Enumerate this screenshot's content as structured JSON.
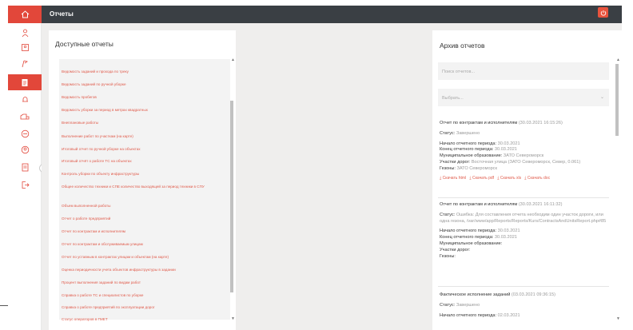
{
  "header": {
    "title": "Отчеты"
  },
  "sidebar": {
    "items": [
      {
        "icon": "users-group-icon"
      },
      {
        "icon": "person-card-icon"
      },
      {
        "icon": "route-flag-icon"
      },
      {
        "icon": "reports-document-icon"
      },
      {
        "icon": "bell-icon"
      },
      {
        "icon": "vehicle-icon"
      },
      {
        "icon": "minus-circle-icon"
      },
      {
        "icon": "person-circle-icon"
      },
      {
        "icon": "settings-document-icon"
      },
      {
        "icon": "logout-arrow-icon"
      }
    ]
  },
  "left_panel": {
    "title": "Доступные отчеты",
    "items": [
      "Ведомость заданий и прохода по треку",
      "Ведомость заданий по ручной уборке",
      "Ведомость пробегов",
      "Ведомость уборки за период в метрах квадратных",
      "Внеплановые работы",
      "Выполнение работ по участкам (на карте)",
      "Итоговый отчет по ручной уборке на объектах",
      "Итоговый отчёт о работе ТС на объектах",
      "Контроль уборки по объекту инфраструктуры",
      "Общее количество техники и СПЕ количество выходящей за период техники в СПУ",
      "Объем выполненной работы",
      "Отчет о работе предприятий",
      "Отчет по контрактам и исполнителям",
      "Отчет по контрактам и обслуживаемым улицам",
      "Отчет по уставным в контрактах улицам и объектам (на карте)",
      "Оценка периодичности учета объектов инфраструктуры в задании",
      "Процент выполнения заданий по видам работ",
      "Справка о работе ТС и специалистов по уборке",
      "Справка о работе предприятий по эксплуатации дорог",
      "Статус операторов в ГМЕТ"
    ]
  },
  "right_panel": {
    "title": "Архив отчетов",
    "search_placeholder": "Поиск отчетов...",
    "select_placeholder": "Выбрать...",
    "reports": [
      {
        "title": "Отчет по контрактам и исполнителям",
        "date": "(30.03.2021 16:15:26)",
        "status_label": "Статус:",
        "status": "Завершено",
        "lines": [
          {
            "label": "Начало отчетного периода:",
            "value": "30.03.2021"
          },
          {
            "label": "Конец отчетного периода:",
            "value": "30.03.2021"
          },
          {
            "label": "Муниципальное образование:",
            "value": "ЗАТО Североморск"
          },
          {
            "label": "Участки дорог:",
            "value": "Восточная улица (ЗАТО Североморск, Север, 0.061)"
          },
          {
            "label": "Гезоны:",
            "value": "ЗАТО Североморск"
          }
        ],
        "links": [
          "Скачать html",
          "Скачать pdf",
          "Скачать xls",
          "Скачать doc"
        ]
      },
      {
        "title": "Отчет по контрактам и исполнителям",
        "date": "(30.03.2021 16:11:32)",
        "status_label": "Статус:",
        "status": "Ошибка: Для составления отчета необходим один участок дороги, или одна гезона, /var/www/app/Reports/Reports/Kurs/ContractsAndUnitsReport.php#85",
        "lines": [
          {
            "label": "Начало отчетного периода:",
            "value": "30.03.2021"
          },
          {
            "label": "Конец отчетного периода:",
            "value": "30.03.2021"
          },
          {
            "label": "Муниципальное образование:",
            "value": ""
          },
          {
            "label": "Участки дорог:",
            "value": ""
          },
          {
            "label": "Гезоны:",
            "value": ""
          }
        ]
      },
      {
        "title": "Фактическое исполнение заданий",
        "date": "(03.03.2021 09:36:15)",
        "status_label": "Статус:",
        "status": "Завершено",
        "lines": [
          {
            "label": "Начало отчетного периода:",
            "value": "02.03.2021"
          }
        ]
      }
    ]
  },
  "colors": {
    "accent": "#e2473a",
    "topbar": "#3a3f44",
    "link": "#e05a4a",
    "background": "#efeeed"
  }
}
